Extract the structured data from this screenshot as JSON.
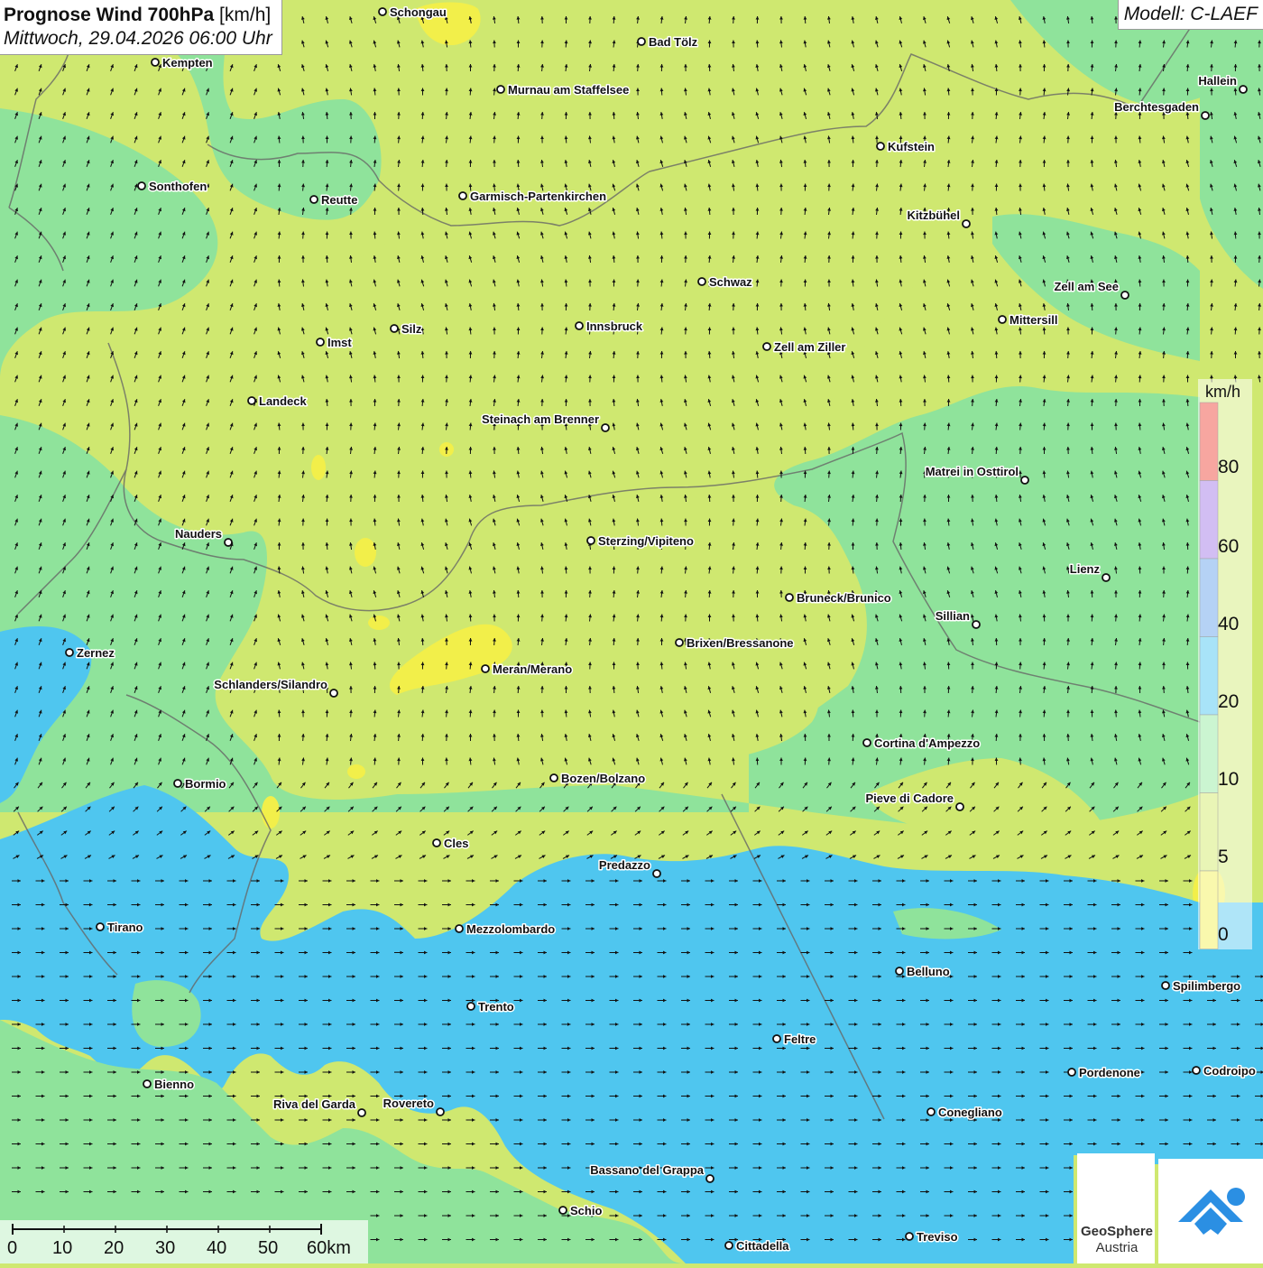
{
  "title": {
    "main_bold": "Prognose Wind 700hPa",
    "unit": "[km/h]",
    "date": "Mittwoch, 29.04.2026 06:00 Uhr"
  },
  "model": "Modell: C-LAEF",
  "legend": {
    "unit": "km/h",
    "labels": [
      "80",
      "60",
      "40",
      "20",
      "10",
      "5",
      "0"
    ],
    "colors": [
      "#ee3a2e",
      "#9b6fe4",
      "#5b9be8",
      "#3fc0ef",
      "#8de89a",
      "#cfe85e",
      "#f2ef4a"
    ]
  },
  "scalebar": {
    "labels": [
      "0",
      "10",
      "20",
      "30",
      "40",
      "50",
      "60km"
    ]
  },
  "logo": {
    "name": "GeoSphere",
    "sub": "Austria"
  },
  "colors": {
    "calm_yellow": "#f2ef4a",
    "light_green": "#cfe870",
    "green": "#8fe39b",
    "cyan": "#4fc6ef",
    "blue": "#5b9be8"
  },
  "cities": [
    {
      "name": "Schongau",
      "label_side": "right"
    },
    {
      "name": "Bad Tölz",
      "label_side": "right"
    },
    {
      "name": "Kempten",
      "label_side": "right"
    },
    {
      "name": "Murnau am Staffelsee",
      "label_side": "right"
    },
    {
      "name": "Hallein",
      "label_side": "left"
    },
    {
      "name": "Berchtesgaden",
      "label_side": "left"
    },
    {
      "name": "Kufstein",
      "label_side": "right"
    },
    {
      "name": "Sonthofen",
      "label_side": "right"
    },
    {
      "name": "Reutte",
      "label_side": "right"
    },
    {
      "name": "Garmisch-Partenkirchen",
      "label_side": "right"
    },
    {
      "name": "Kitzbühel",
      "label_side": "left"
    },
    {
      "name": "Schwaz",
      "label_side": "right"
    },
    {
      "name": "Zell am See",
      "label_side": "left"
    },
    {
      "name": "Mittersill",
      "label_side": "right"
    },
    {
      "name": "Imst",
      "label_side": "right"
    },
    {
      "name": "Silz",
      "label_side": "right"
    },
    {
      "name": "Innsbruck",
      "label_side": "right"
    },
    {
      "name": "Zell am Ziller",
      "label_side": "right"
    },
    {
      "name": "Landeck",
      "label_side": "right"
    },
    {
      "name": "Steinach am Brenner",
      "label_side": "left"
    },
    {
      "name": "Matrei in Osttirol",
      "label_side": "left"
    },
    {
      "name": "Nauders",
      "label_side": "left"
    },
    {
      "name": "Sterzing/Vipiteno",
      "label_side": "right"
    },
    {
      "name": "Lienz",
      "label_side": "left"
    },
    {
      "name": "Bruneck/Brunico",
      "label_side": "right"
    },
    {
      "name": "Sillian",
      "label_side": "left"
    },
    {
      "name": "Brixen/Bressanone",
      "label_side": "right"
    },
    {
      "name": "Zernez",
      "label_side": "right"
    },
    {
      "name": "Meran/Merano",
      "label_side": "right"
    },
    {
      "name": "Schlanders/Silandro",
      "label_side": "left"
    },
    {
      "name": "Cortina d'Ampezzo",
      "label_side": "right"
    },
    {
      "name": "Bozen/Bolzano",
      "label_side": "right"
    },
    {
      "name": "Bormio",
      "label_side": "right"
    },
    {
      "name": "Pieve di Cadore",
      "label_side": "left"
    },
    {
      "name": "Cles",
      "label_side": "right"
    },
    {
      "name": "Predazzo",
      "label_side": "left"
    },
    {
      "name": "Tirano",
      "label_side": "right"
    },
    {
      "name": "Mezzolombardo",
      "label_side": "right"
    },
    {
      "name": "Belluno",
      "label_side": "right"
    },
    {
      "name": "Spilimbergo",
      "label_side": "right"
    },
    {
      "name": "Trento",
      "label_side": "right"
    },
    {
      "name": "Feltre",
      "label_side": "right"
    },
    {
      "name": "Pordenone",
      "label_side": "right"
    },
    {
      "name": "Codroipo",
      "label_side": "right"
    },
    {
      "name": "Bienno",
      "label_side": "right"
    },
    {
      "name": "Riva del Garda",
      "label_side": "left"
    },
    {
      "name": "Rovereto",
      "label_side": "left"
    },
    {
      "name": "Conegliano",
      "label_side": "right"
    },
    {
      "name": "Bassano del Grappa",
      "label_side": "left"
    },
    {
      "name": "Schio",
      "label_side": "right"
    },
    {
      "name": "Treviso",
      "label_side": "right"
    },
    {
      "name": "Cittadella",
      "label_side": "right"
    }
  ]
}
